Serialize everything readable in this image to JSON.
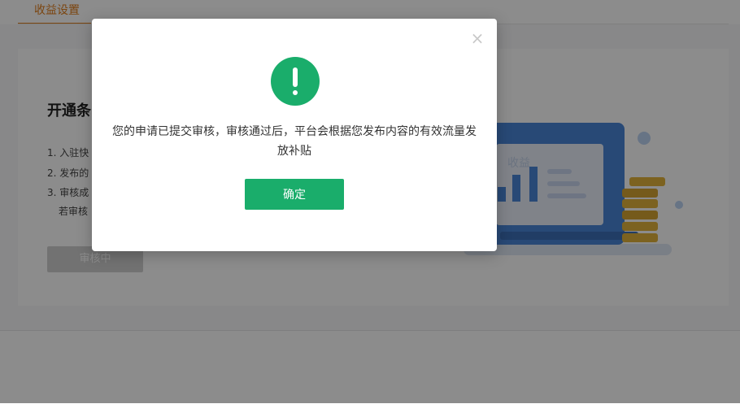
{
  "tabs": {
    "active_label": "收益设置"
  },
  "card": {
    "title": "开通条",
    "rules": [
      "1. 入驻快",
      "2. 发布的",
      "3. 审核成",
      "若审核"
    ],
    "status_button_label": "审核中"
  },
  "illustration": {
    "screen_label": "收益"
  },
  "modal": {
    "close_glyph": "×",
    "message": "您的申请已提交审核，审核通过后，平台会根据您发布内容的有效流量发放补贴",
    "confirm_label": "确定"
  },
  "colors": {
    "brand_orange": "#e07f1d",
    "success_green": "#1aad6b",
    "illustration_blue": "#4a86d8",
    "coin_gold": "#e2b23b"
  }
}
